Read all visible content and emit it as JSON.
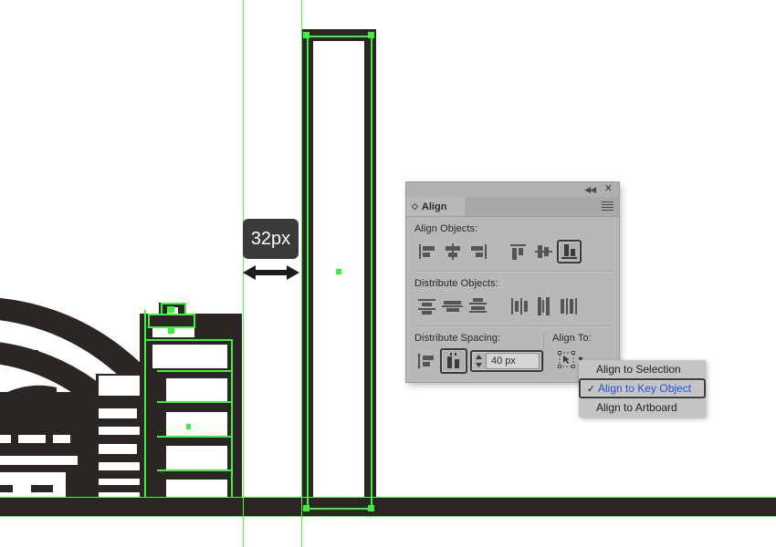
{
  "app": {
    "canvas_background": "#ffffff",
    "artwork_color": "#2b2523",
    "selection_color": "#3ef03e",
    "guide_color": "#4df04d"
  },
  "measurement_tooltip": {
    "label": "32px",
    "icon": "double-headed-arrow-icon"
  },
  "align_panel": {
    "tab_label": "Align",
    "tab_icon": "panel-options-diamond-icon",
    "collapse_icon": "double-chevron-left-icon",
    "close_icon": "close-icon",
    "menu_icon": "panel-menu-hamburger-icon",
    "align_objects": {
      "label": "Align Objects:",
      "buttons": [
        {
          "name": "horizontal-align-left",
          "icon": "align-left-icon",
          "pressed": false
        },
        {
          "name": "horizontal-align-center",
          "icon": "align-center-horizontal-icon",
          "pressed": false
        },
        {
          "name": "horizontal-align-right",
          "icon": "align-right-icon",
          "pressed": false
        },
        {
          "name": "vertical-align-top",
          "icon": "align-top-icon",
          "pressed": false
        },
        {
          "name": "vertical-align-center",
          "icon": "align-center-vertical-icon",
          "pressed": false
        },
        {
          "name": "vertical-align-bottom",
          "icon": "align-bottom-icon",
          "pressed": true
        }
      ]
    },
    "distribute_objects": {
      "label": "Distribute Objects:",
      "buttons": [
        {
          "name": "vertical-distribute-top",
          "icon": "distribute-top-icon",
          "pressed": false
        },
        {
          "name": "vertical-distribute-center",
          "icon": "distribute-vcenter-icon",
          "pressed": false
        },
        {
          "name": "vertical-distribute-bottom",
          "icon": "distribute-bottom-icon",
          "pressed": false
        },
        {
          "name": "horizontal-distribute-left",
          "icon": "distribute-left-icon",
          "pressed": false
        },
        {
          "name": "horizontal-distribute-center",
          "icon": "distribute-hcenter-icon",
          "pressed": false
        },
        {
          "name": "horizontal-distribute-right",
          "icon": "distribute-right-icon",
          "pressed": false
        }
      ]
    },
    "distribute_spacing": {
      "label": "Distribute Spacing:",
      "auto_button_icon": "vertical-distribute-spacing-icon",
      "fixed_button_icon": "horizontal-distribute-spacing-icon",
      "fixed_button_pressed": true,
      "value": "40 px",
      "stepper_icon": "stepper-up-down-icon"
    },
    "align_to": {
      "label": "Align To:",
      "button_icon": "align-to-key-object-icon",
      "chevron_icon": "chevron-down-icon"
    }
  },
  "align_to_menu": {
    "items": [
      {
        "label": "Align to Selection",
        "checked": false,
        "selected": false
      },
      {
        "label": "Align to Key Object",
        "checked": true,
        "selected": true
      },
      {
        "label": "Align to Artboard",
        "checked": false,
        "selected": false
      }
    ],
    "checkmark_glyph": "✓",
    "highlight_color": "#2255dd"
  }
}
